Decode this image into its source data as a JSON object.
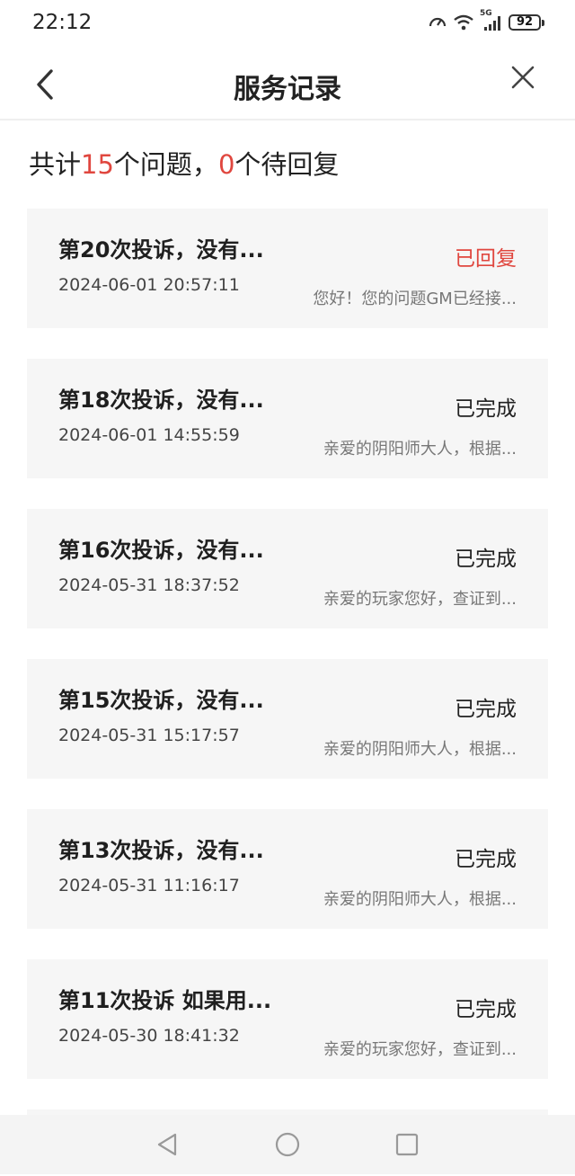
{
  "status_bar": {
    "time": "22:12",
    "network_label": "5G",
    "battery": "92",
    "icons": [
      "speed-icon",
      "wifi-icon",
      "signal-icon",
      "battery-icon"
    ]
  },
  "header": {
    "title": "服务记录",
    "back_icon": "chevron-left-icon",
    "close_icon": "close-icon"
  },
  "summary": {
    "prefix": "共计",
    "total": "15",
    "middle": "个问题，",
    "pending": "0",
    "suffix": "个待回复",
    "accent_color": "#e0473f"
  },
  "records": [
    {
      "title": "第20次投诉，没有...",
      "time": "2024-06-01 20:57:11",
      "status": "已回复",
      "preview": "您好！您的问题GM已经接..."
    },
    {
      "title": "第18次投诉，没有...",
      "time": "2024-06-01 14:55:59",
      "status": "已完成",
      "preview": "亲爱的阴阳师大人，根据..."
    },
    {
      "title": "第16次投诉，没有...",
      "time": "2024-05-31 18:37:52",
      "status": "已完成",
      "preview": "亲爱的玩家您好，查证到..."
    },
    {
      "title": "第15次投诉，没有...",
      "time": "2024-05-31 15:17:57",
      "status": "已完成",
      "preview": "亲爱的阴阳师大人，根据..."
    },
    {
      "title": "第13次投诉，没有...",
      "time": "2024-05-31 11:16:17",
      "status": "已完成",
      "preview": "亲爱的阴阳师大人，根据..."
    },
    {
      "title": "第11次投诉 如果用...",
      "time": "2024-05-30 18:41:32",
      "status": "已完成",
      "preview": "亲爱的玩家您好，查证到..."
    }
  ],
  "nav_bar": {
    "icons": [
      "back-triangle-icon",
      "home-circle-icon",
      "recents-square-icon"
    ]
  }
}
